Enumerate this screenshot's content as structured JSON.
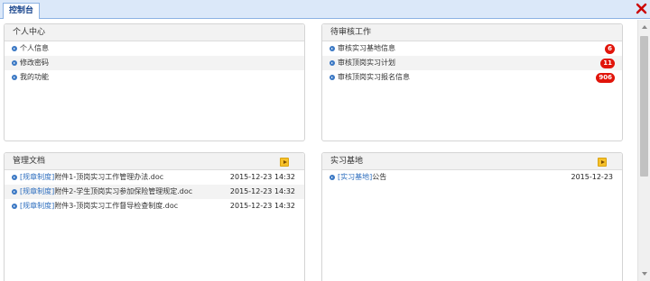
{
  "tabbar": {
    "active_tab": "控制台"
  },
  "panels": {
    "personal": {
      "title": "个人中心",
      "items": [
        "个人信息",
        "修改密码",
        "我的功能"
      ]
    },
    "pending": {
      "title": "待审核工作",
      "items": [
        {
          "label": "审核实习基地信息",
          "count": "6"
        },
        {
          "label": "审核顶岗实习计划",
          "count": "11"
        },
        {
          "label": "审核顶岗实习报名信息",
          "count": "906"
        }
      ]
    },
    "docs": {
      "title": "管理文档",
      "items": [
        {
          "tag": "[规章制度]",
          "name": "附件1-顶岗实习工作管理办法.doc",
          "date": "2015-12-23 14:32"
        },
        {
          "tag": "[规章制度]",
          "name": "附件2-学生顶岗实习参加保险管理规定.doc",
          "date": "2015-12-23 14:32"
        },
        {
          "tag": "[规章制度]",
          "name": "附件3-顶岗实习工作督导检查制度.doc",
          "date": "2015-12-23 14:32"
        }
      ]
    },
    "bases": {
      "title": "实习基地",
      "items": [
        {
          "tag": "[实习基地]",
          "name": "公告",
          "date": "2015-12-23"
        }
      ]
    }
  },
  "colors": {
    "badge": "#e1140a",
    "tag_link": "#2f6fbf",
    "tab_text": "#15428b",
    "close": "#cc0000"
  }
}
